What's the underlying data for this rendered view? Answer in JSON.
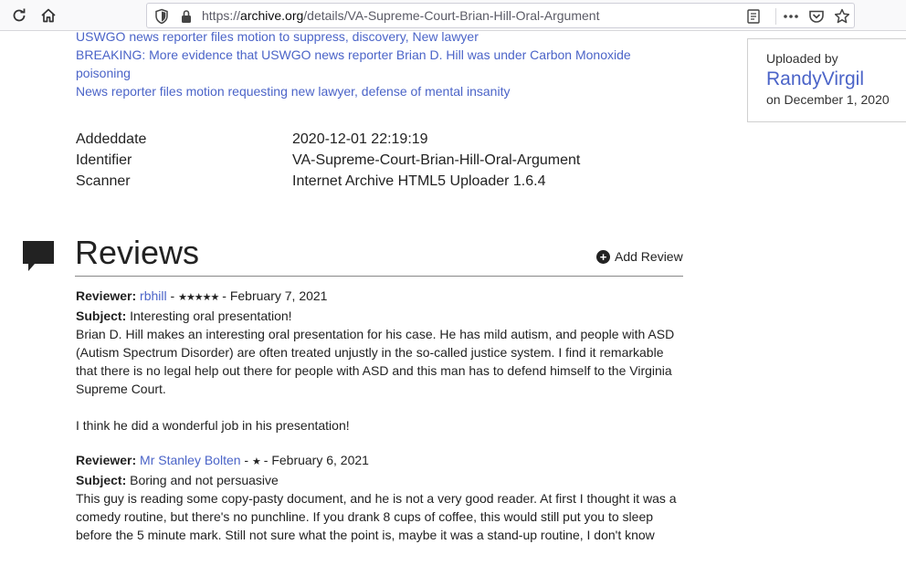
{
  "browser": {
    "url_prefix": "https://",
    "url_domain": "archive.org",
    "url_path": "/details/VA-Supreme-Court-Brian-Hill-Oral-Argument"
  },
  "related_links": [
    "USWGO news reporter files motion to suppress, discovery, New lawyer",
    "BREAKING: More evidence that USWGO news reporter Brian D. Hill was under Carbon Monoxide poisoning",
    "News reporter files motion requesting new lawyer, defense of mental insanity"
  ],
  "metadata": [
    {
      "key": "Addeddate",
      "value": "2020-12-01 22:19:19"
    },
    {
      "key": "Identifier",
      "value": "VA-Supreme-Court-Brian-Hill-Oral-Argument"
    },
    {
      "key": "Scanner",
      "value": "Internet Archive HTML5 Uploader 1.6.4"
    }
  ],
  "uploader": {
    "label": "Uploaded by",
    "name": "RandyVirgil",
    "date": "on December 1, 2020"
  },
  "reviews_section": {
    "title": "Reviews",
    "add_label": "Add Review"
  },
  "reviews": [
    {
      "reviewer_label": "Reviewer:",
      "reviewer": "rbhill",
      "stars": "★★★★★",
      "date": "February 7, 2021",
      "subject_label": "Subject:",
      "subject": "Interesting oral presentation!",
      "body1": "Brian D. Hill makes an interesting oral presentation for his case. He has mild autism, and people with ASD (Autism Spectrum Disorder) are often treated unjustly in the so-called justice system. I find it remarkable that there is no legal help out there for people with ASD and this man has to defend himself to the Virginia Supreme Court.",
      "body2": "I think he did a wonderful job in his presentation!"
    },
    {
      "reviewer_label": "Reviewer:",
      "reviewer": "Mr Stanley Bolten",
      "stars": "★",
      "date": "February 6, 2021",
      "subject_label": "Subject:",
      "subject": "Boring and not persuasive",
      "body1": "This guy is reading some copy-pasty document, and he is not a very good reader. At first I thought it was a comedy routine, but there's no punchline. If you drank 8 cups of coffee, this would still put you to sleep before the 5 minute mark. Still not sure what the point is, maybe it was a stand-up routine, I don't know"
    }
  ],
  "colors": {
    "link": "#4b64c8",
    "text": "#222222",
    "toolbar_bg": "#f9f9fa"
  }
}
